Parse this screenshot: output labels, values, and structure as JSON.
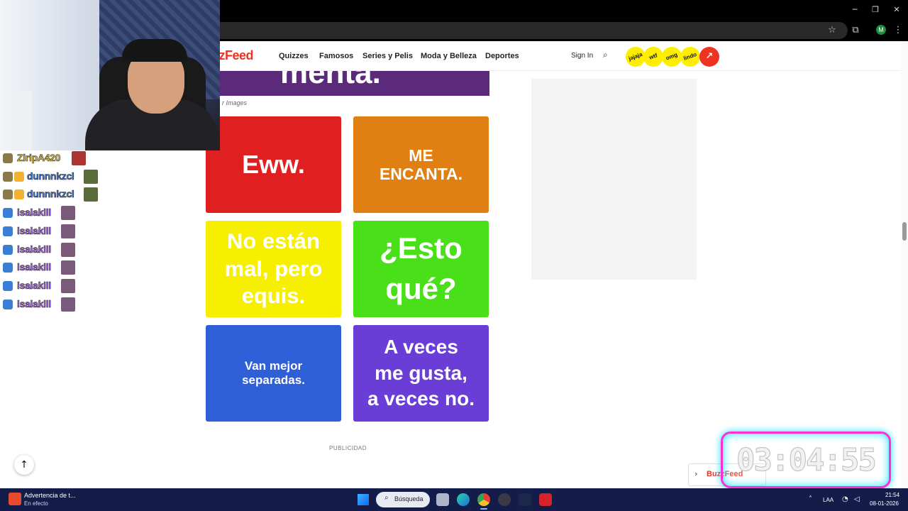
{
  "browser": {
    "window_controls": {
      "minimize": "─",
      "restore": "❐",
      "close": "✕"
    },
    "icons": {
      "bookmark": "star-icon",
      "extensions": "puzzle-icon",
      "menu": "kebab-menu-icon"
    },
    "profile_initial": "M"
  },
  "site": {
    "logo": "zzFeed",
    "nav": [
      "Quizzes",
      "Famosos",
      "Series y Pelis",
      "Moda y Belleza",
      "Deportes"
    ],
    "sign_in": "Sign In",
    "badges": [
      "jajaja",
      "wtf",
      "omg",
      "lindo"
    ],
    "trending_glyph": "↗",
    "accent": "#e32222"
  },
  "article": {
    "hero_text": "menta.",
    "caption": "r Images",
    "tiles": [
      {
        "lines": [
          "Eww."
        ],
        "color": "#e02020"
      },
      {
        "lines": [
          "ME",
          "ENCANTA."
        ],
        "color": "#e07f12"
      },
      {
        "lines": [
          "No están",
          "mal, pero",
          "equis."
        ],
        "color": "#f6ef00"
      },
      {
        "lines": [
          "¿Esto",
          "qué?"
        ],
        "color": "#49e019"
      },
      {
        "lines": [
          "Van mejor",
          "separadas."
        ],
        "color": "#2e5fd6"
      },
      {
        "lines": [
          "A veces",
          "me gusta,",
          "a veces no."
        ],
        "color": "#6a3ed6"
      }
    ],
    "advert_label": "PUBLICIDAD",
    "footer_brand": "BuzzFeed",
    "scroll_top_glyph": "↑"
  },
  "chat": {
    "messages": [
      {
        "user": "ZiripA420",
        "color": "#e9c54a"
      },
      {
        "user": "dunnnkzcl",
        "color": "#4a7fe0"
      },
      {
        "user": "dunnnkzcl",
        "color": "#4a7fe0"
      },
      {
        "user": "isaiaklll",
        "color": "#b36cf0"
      },
      {
        "user": "isaiaklll",
        "color": "#b36cf0"
      },
      {
        "user": "isaiaklll",
        "color": "#b36cf0"
      },
      {
        "user": "isaiaklll",
        "color": "#b36cf0"
      },
      {
        "user": "isaiaklll",
        "color": "#b36cf0"
      },
      {
        "user": "isaiaklll",
        "color": "#b36cf0"
      }
    ]
  },
  "timer": {
    "value": "03:04:55"
  },
  "taskbar": {
    "notification_title": "Advertencia de t...",
    "notification_sub": "En efecto",
    "search_label": "Búsqueda",
    "language": "LAA",
    "time": "21:54",
    "date": "08-01-2026"
  }
}
